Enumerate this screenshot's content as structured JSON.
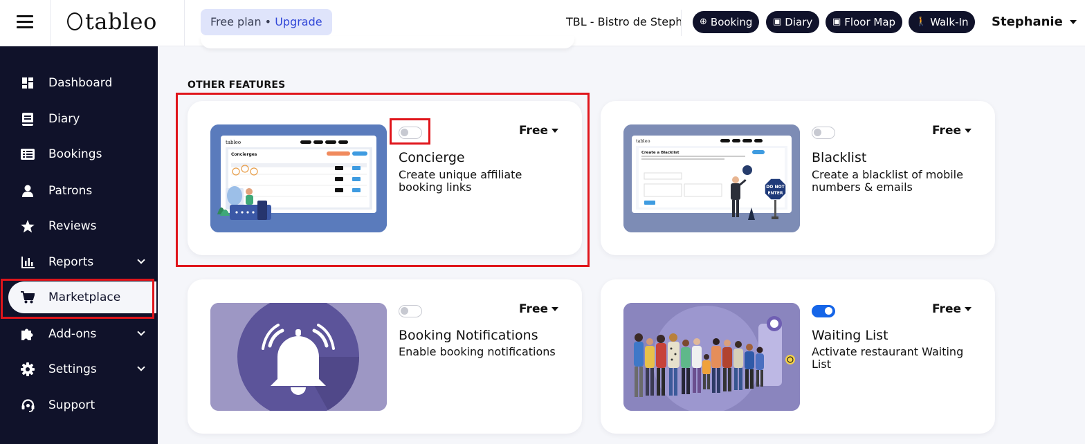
{
  "topbar": {
    "logo_text": "tableo",
    "plan_text": "Free plan • ",
    "upgrade_label": "Upgrade",
    "venue_name": "TBL - Bistro de Steph",
    "buttons": [
      {
        "label": "Booking",
        "icon": "plus-circle-icon"
      },
      {
        "label": "Diary",
        "icon": "calendar-icon"
      },
      {
        "label": "Floor Map",
        "icon": "calendar-icon"
      },
      {
        "label": "Walk-In",
        "icon": "walk-icon"
      }
    ],
    "user_name": "Stephanie"
  },
  "sidebar": {
    "items": [
      {
        "label": "Dashboard",
        "icon": "dashboard-icon"
      },
      {
        "label": "Diary",
        "icon": "book-icon"
      },
      {
        "label": "Bookings",
        "icon": "list-icon"
      },
      {
        "label": "Patrons",
        "icon": "person-icon"
      },
      {
        "label": "Reviews",
        "icon": "star-icon"
      },
      {
        "label": "Reports",
        "icon": "chart-icon",
        "expandable": true
      },
      {
        "label": "Marketplace",
        "icon": "cart-icon",
        "active": true
      },
      {
        "label": "Add-ons",
        "icon": "puzzle-icon",
        "expandable": true
      },
      {
        "label": "Settings",
        "icon": "gear-icon",
        "expandable": true
      },
      {
        "label": "Support",
        "icon": "headset-icon"
      }
    ]
  },
  "main": {
    "section_title": "OTHER FEATURES",
    "features": [
      {
        "title": "Concierge",
        "description": "Create unique affiliate booking links",
        "price": "Free",
        "enabled": false
      },
      {
        "title": "Blacklist",
        "description": "Create a blacklist of mobile numbers & emails",
        "price": "Free",
        "enabled": false
      },
      {
        "title": "Booking Notifications",
        "description": "Enable booking notifications",
        "price": "Free",
        "enabled": false
      },
      {
        "title": "Waiting List",
        "description": "Activate restaurant Waiting List",
        "price": "Free",
        "enabled": true
      }
    ],
    "thumbs": {
      "concierge_heading": "Concierges",
      "blacklist_heading": "Create a Blacklist",
      "sign_line1": "DO NOT",
      "sign_line2": "ENTER"
    }
  },
  "colors": {
    "sidebar_bg": "#10122a",
    "accent_blue": "#1565e8",
    "upgrade_blue": "#3248d8",
    "highlight_red": "#e0151b",
    "notif_purple": "#9d97c4",
    "waiting_purple": "#8b86bf"
  }
}
